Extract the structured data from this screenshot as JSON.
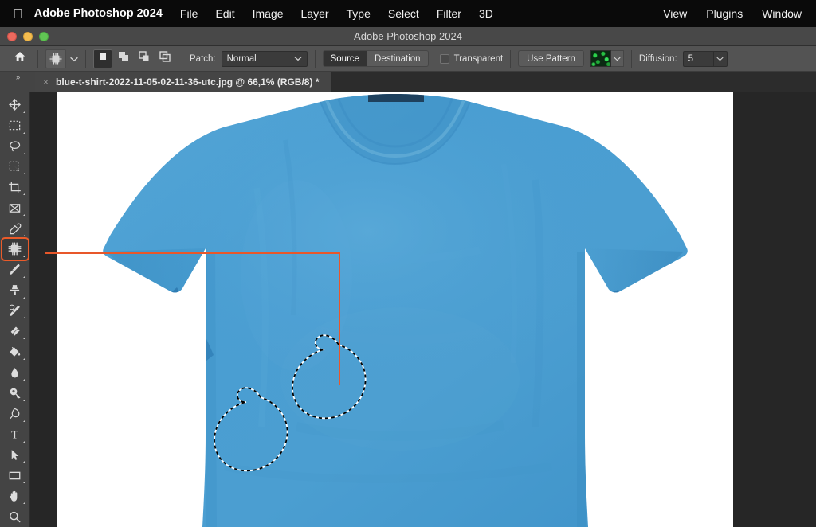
{
  "menubar": {
    "apple_glyph": "",
    "app_name": "Adobe Photoshop 2024",
    "left_items": [
      "File",
      "Edit",
      "Image",
      "Layer",
      "Type",
      "Select",
      "Filter",
      "3D"
    ],
    "right_items": [
      "View",
      "Plugins",
      "Window"
    ]
  },
  "window": {
    "title": "Adobe Photoshop 2024",
    "traffic_lights": [
      "close-button",
      "minimize-button",
      "zoom-button"
    ]
  },
  "options_bar": {
    "home_icon": "home-icon",
    "tool_preset_icon": "patch-tool-icon",
    "tool_preset_caret": "chevron-down-icon",
    "selection_modes": [
      {
        "name": "new-selection",
        "icon": "new-selection-icon",
        "active": true
      },
      {
        "name": "add-to-selection",
        "icon": "add-to-selection-icon",
        "active": false
      },
      {
        "name": "subtract-from-selection",
        "icon": "subtract-from-selection-icon",
        "active": false
      },
      {
        "name": "intersect-selection",
        "icon": "intersect-selection-icon",
        "active": false
      }
    ],
    "patch_label": "Patch:",
    "patch_value": "Normal",
    "patch_caret": "chevron-down-icon",
    "source_label": "Source",
    "source_active": true,
    "destination_label": "Destination",
    "destination_active": false,
    "transparent_label": "Transparent",
    "transparent_checked": false,
    "use_pattern_label": "Use Pattern",
    "pattern_swatch_name": "green-texture-pattern-swatch",
    "pattern_caret": "chevron-down-icon",
    "diffusion_label": "Diffusion:",
    "diffusion_value": "5",
    "diffusion_caret": "chevron-down-icon"
  },
  "tabbar": {
    "panel_toggle_glyph": "»",
    "close_glyph": "×",
    "document_title": "blue-t-shirt-2022-11-05-02-11-36-utc.jpg @ 66,1% (RGB/8) *"
  },
  "toolbar": {
    "items": [
      {
        "name": "move-tool",
        "icon": "move-icon",
        "selected": false
      },
      {
        "name": "rectangular-marquee-tool",
        "icon": "marquee-icon",
        "selected": false
      },
      {
        "name": "lasso-tool",
        "icon": "lasso-icon",
        "selected": false
      },
      {
        "name": "object-selection-tool",
        "icon": "magic-wand-icon",
        "selected": false
      },
      {
        "name": "crop-tool",
        "icon": "crop-icon",
        "selected": false
      },
      {
        "name": "frame-tool",
        "icon": "frame-icon",
        "selected": false
      },
      {
        "name": "eyedropper-tool",
        "icon": "eyedropper-icon",
        "selected": false
      },
      {
        "name": "patch-tool",
        "icon": "patch-icon",
        "selected": true
      },
      {
        "name": "brush-tool",
        "icon": "brush-icon",
        "selected": false
      },
      {
        "name": "clone-stamp-tool",
        "icon": "clone-stamp-icon",
        "selected": false
      },
      {
        "name": "history-brush-tool",
        "icon": "history-brush-icon",
        "selected": false
      },
      {
        "name": "eraser-tool",
        "icon": "eraser-icon",
        "selected": false
      },
      {
        "name": "gradient-tool",
        "icon": "paint-bucket-icon",
        "selected": false
      },
      {
        "name": "blur-tool",
        "icon": "blur-drop-icon",
        "selected": false
      },
      {
        "name": "dodge-tool",
        "icon": "dodge-icon",
        "selected": false
      },
      {
        "name": "pen-tool",
        "icon": "pen-icon",
        "selected": false
      },
      {
        "name": "horizontal-type-tool",
        "icon": "type-t-icon",
        "selected": false
      },
      {
        "name": "path-selection-tool",
        "icon": "path-arrow-icon",
        "selected": false
      },
      {
        "name": "rectangle-tool",
        "icon": "rectangle-icon",
        "selected": false
      },
      {
        "name": "hand-tool",
        "icon": "hand-icon",
        "selected": false
      },
      {
        "name": "zoom-tool",
        "icon": "magnifier-icon",
        "selected": false
      }
    ]
  },
  "canvas": {
    "document_name": "blue-t-shirt-2022-11-05-02-11-36-utc.jpg",
    "zoom_level": "66,1%",
    "color_mode": "RGB/8",
    "unsaved_changes": true,
    "background_color": "#ffffff",
    "workspace_color": "#262626",
    "shirt_color": "#4a9ed2",
    "shirt_shadow_color": "#2f7fb5",
    "selection_style": "marching-ants",
    "selection_shapes": 2,
    "annotation": {
      "color": "#e8572a",
      "name": "patch-tool-callout-line",
      "from": "patch-tool-button",
      "to": "selection-anchor-point"
    }
  }
}
